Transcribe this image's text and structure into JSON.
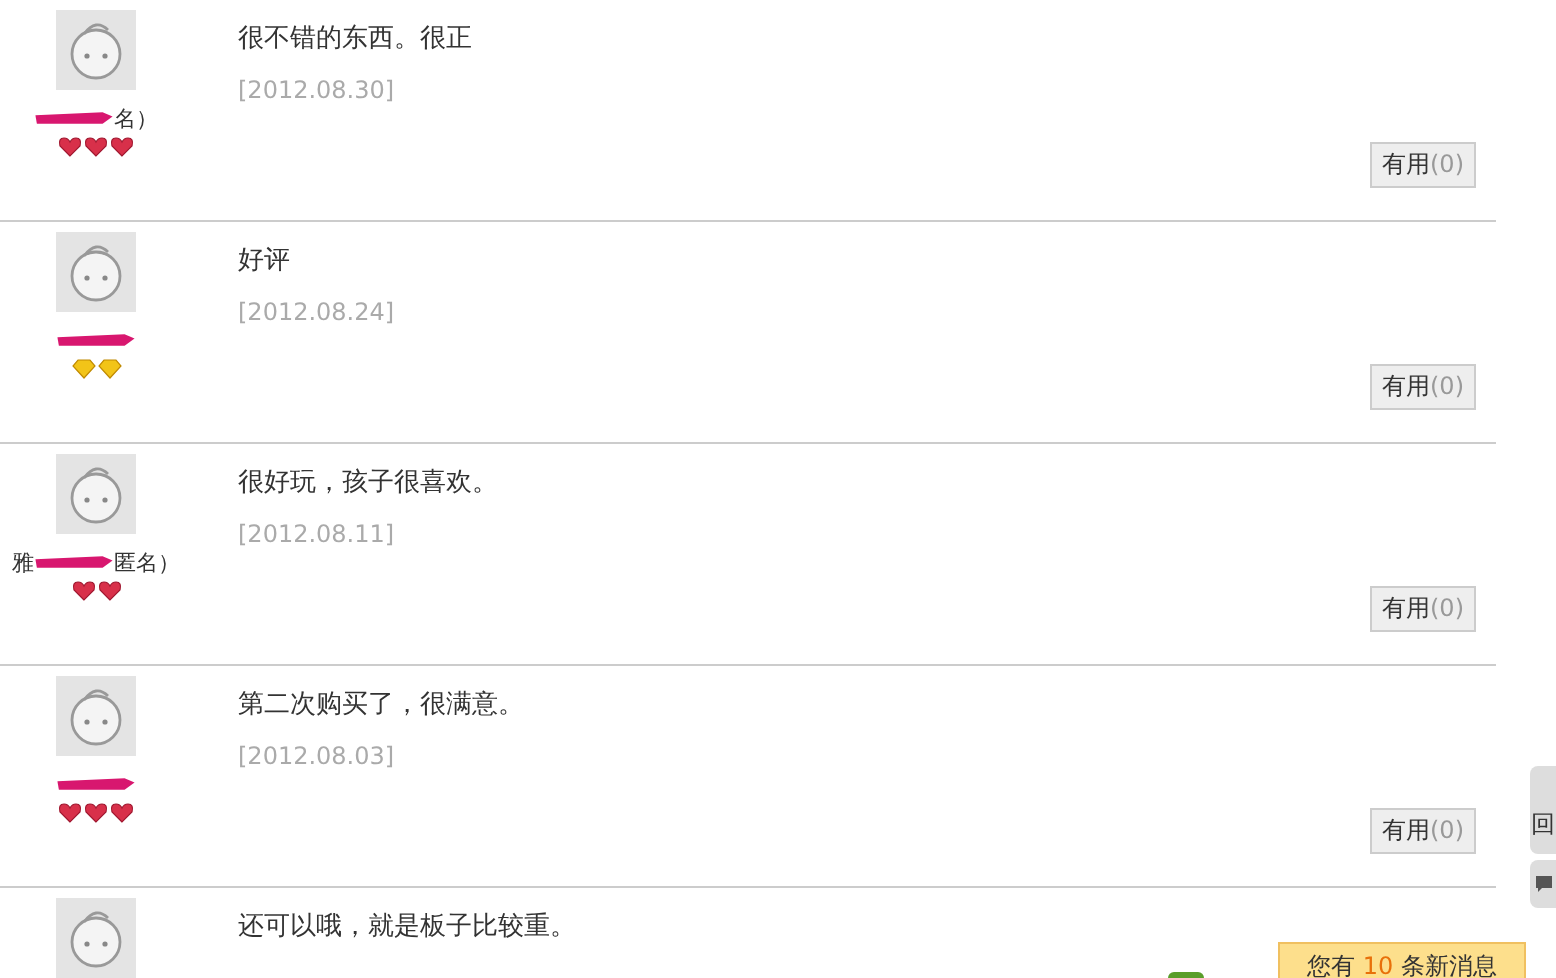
{
  "reviews": [
    {
      "name_right": "名）",
      "badges": [
        {
          "kind": "heart"
        },
        {
          "kind": "heart"
        },
        {
          "kind": "heart"
        }
      ],
      "comment": "很不错的东西。很正",
      "date": "[2012.08.30]",
      "useful_button": "有用",
      "useful_count": "(0)"
    },
    {
      "badges": [
        {
          "kind": "diamond"
        },
        {
          "kind": "diamond"
        }
      ],
      "comment": "好评",
      "date": "[2012.08.24]",
      "useful_button": "有用",
      "useful_count": "(0)"
    },
    {
      "name_left": "雅",
      "name_right": "匿名）",
      "badges": [
        {
          "kind": "heart"
        },
        {
          "kind": "heart"
        }
      ],
      "comment": "很好玩，孩子很喜欢。",
      "date": "[2012.08.11]",
      "useful_button": "有用",
      "useful_count": "(0)"
    },
    {
      "badges": [
        {
          "kind": "heart"
        },
        {
          "kind": "heart"
        },
        {
          "kind": "heart"
        }
      ],
      "comment": "第二次购买了，很满意。",
      "date": "[2012.08.03]",
      "useful_button": "有用",
      "useful_count": "(0)"
    },
    {
      "comment": "还可以哦，就是板子比较重。"
    }
  ],
  "side_tab": {
    "text": "回"
  },
  "notification": {
    "prefix": "您有",
    "count": "10",
    "suffix": "条新消息"
  }
}
